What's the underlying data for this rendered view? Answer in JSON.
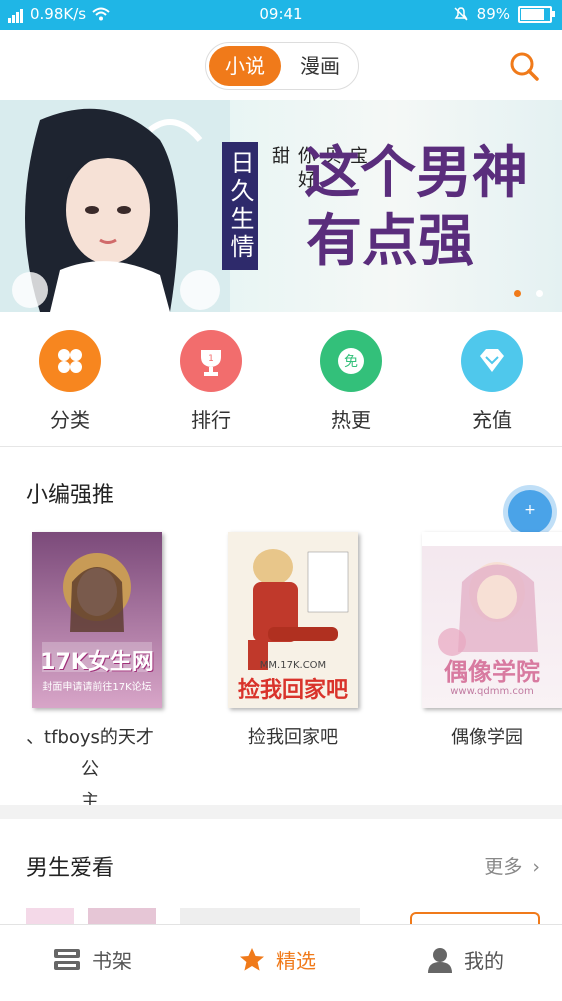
{
  "status_bar": {
    "left_text": "0.98K/s",
    "time": "09:41",
    "battery": "89%",
    "battery_level": 0.89
  },
  "header": {
    "segments": [
      "小说",
      "漫画"
    ],
    "active_segment": 0
  },
  "banner": {
    "tag_vertical": "日久生情",
    "tag_small": "宝贝，你好甜",
    "title_line1": "这个男神",
    "title_line2": "有点强",
    "page_count": 2,
    "active_page": 0
  },
  "categories": [
    {
      "label": "分类",
      "icon": "grid-icon",
      "color": "#f7861f"
    },
    {
      "label": "排行",
      "icon": "trophy-icon",
      "color": "#f26d6d"
    },
    {
      "label": "热更",
      "icon": "free-icon",
      "color": "#33c07a"
    },
    {
      "label": "充值",
      "icon": "diamond-icon",
      "color": "#4fc8ec"
    }
  ],
  "editor_picks": {
    "title": "小编强推",
    "books": [
      {
        "title_line1": "、tfboys的天才公",
        "title_line2": "主",
        "cover_text": "17K女生网",
        "cover_sub": "封面申请请前往17K论坛"
      },
      {
        "title_line1": "捡我回家吧",
        "title_line2": "",
        "cover_text": "捡我回家吧",
        "cover_sub": "MM.17K.COM"
      },
      {
        "title_line1": "偶像学园",
        "title_line2": "",
        "cover_text": "偶像学院",
        "cover_sub": "www.qdmm.com"
      }
    ]
  },
  "boys_section": {
    "title": "男生爱看",
    "more_label": "更多"
  },
  "tabbar": {
    "items": [
      {
        "label": "书架",
        "icon": "bookshelf-icon"
      },
      {
        "label": "精选",
        "icon": "star-icon"
      },
      {
        "label": "我的",
        "icon": "user-icon"
      }
    ],
    "active": 1,
    "accent": "#f07a1a"
  }
}
